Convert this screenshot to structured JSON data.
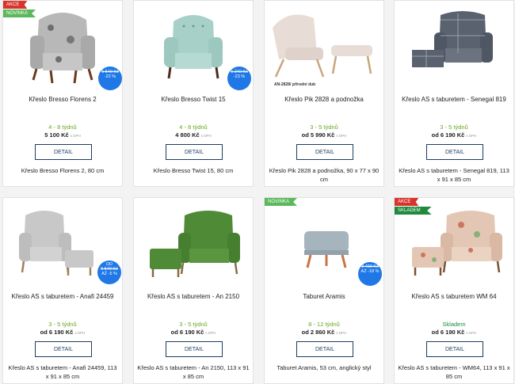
{
  "labels": {
    "akce": "AKCE",
    "novinka": "NOVINKA",
    "skladem": "SKLADEM",
    "detail": "DETAIL",
    "vat": "s DPH"
  },
  "products": [
    {
      "name": "Křeslo Bresso Florens 2",
      "delivery": "4 - 8 týdnů",
      "price": "5 100 Kč",
      "sub": "Křeslo Bresso Florens 2, 80 cm",
      "sale": {
        "old": "6 540 Kč",
        "pct": "-22 %"
      }
    },
    {
      "name": "Křeslo Bresso Twist 15",
      "delivery": "4 - 8 týdnů",
      "price": "4 800 Kč",
      "sub": "Křeslo Bresso Twist 15, 80 cm",
      "sale": {
        "old": "6 240 Kč",
        "pct": "-23 %"
      }
    },
    {
      "name": "Křeslo Pik 2828 a podnožka",
      "delivery": "3 - 5 týdnů",
      "price": "od 5 990 Kč",
      "sub": "Křeslo Pik 2828 a podnožka, 90 x 77 x 90 cm",
      "caption": "AN-2828/ přírodní dub"
    },
    {
      "name": "Křeslo AS s taburetem - Senegal 819",
      "delivery": "3 - 5 týdnů",
      "price": "od 6 190 Kč",
      "sub": "Křeslo AS s taburetem - Senegal 819, 113 x 91 x 85 cm"
    },
    {
      "name": "Křeslo AS s taburetem - Anafi 24459",
      "delivery": "3 - 5 týdnů",
      "price": "od 6 190 Kč",
      "sub": "Křeslo AS s taburetem - Anafi 24459, 113 x 91 x 85 cm",
      "sale": {
        "prefix": "OD",
        "old": "6 540 Kč",
        "pct": "AŽ -5 %"
      }
    },
    {
      "name": "Křeslo AS s taburetem - An 2150",
      "delivery": "3 - 5 týdnů",
      "price": "od 6 190 Kč",
      "sub": "Křeslo AS s taburetem - An 2150, 113 x 91 x 85 cm"
    },
    {
      "name": "Taburet Aramis",
      "delivery": "8 - 12 týdnů",
      "price": "od 2 860 Kč",
      "sub": "Taburet Aramis, 53 cm, anglický styl",
      "sale": {
        "old": "3 490 Kč",
        "pct": "AŽ -18 %"
      }
    },
    {
      "name": "Křeslo AS s taburetem WM 64",
      "delivery": "Skladem",
      "price": "od 6 190 Kč",
      "sub": "Křeslo AS s taburetem - WM64, 113 x 91 x 85 cm"
    }
  ]
}
